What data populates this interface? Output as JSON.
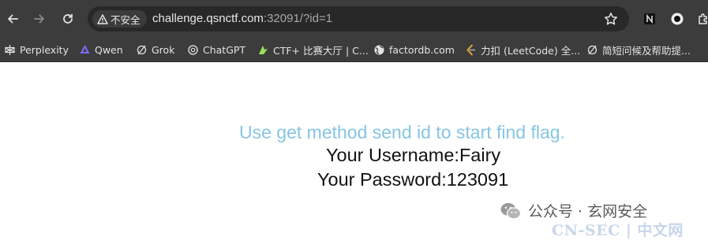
{
  "browser": {
    "security_label": "不安全",
    "url_host": "challenge.qsnctf.com",
    "url_rest": ":32091/?id=1"
  },
  "bookmarks": [
    {
      "label": "Perplexity",
      "icon": "perplexity-icon"
    },
    {
      "label": "Qwen",
      "icon": "qwen-icon"
    },
    {
      "label": "Grok",
      "icon": "grok-icon"
    },
    {
      "label": "ChatGPT",
      "icon": "chatgpt-icon"
    },
    {
      "label": "CTF+ 比赛大厅 | C...",
      "icon": "ctf-icon"
    },
    {
      "label": "factordb.com",
      "icon": "globe-icon"
    },
    {
      "label": "力扣 (LeetCode) 全...",
      "icon": "leetcode-icon"
    },
    {
      "label": "简短问候及帮助提...",
      "icon": "grok-icon"
    }
  ],
  "page": {
    "hint": "Use get method send id to start find flag.",
    "username_line": "Your Username:Fairy",
    "password_line": "Your Password:123091"
  },
  "watermark": {
    "text": "公众号 · 玄网安全",
    "secondary": "CN-SEC | 中文网"
  },
  "colors": {
    "hint": "#86c5e3",
    "toolbar": "#3c3c3c",
    "omnibox": "#282828"
  }
}
